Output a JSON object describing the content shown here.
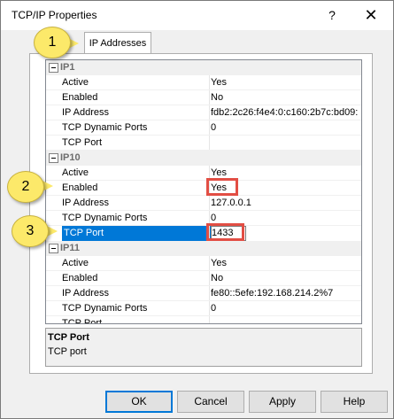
{
  "window": {
    "title": "TCP/IP Properties",
    "help": "?",
    "close": "✕"
  },
  "tabs": [
    {
      "label": "IP Addresses"
    }
  ],
  "grid": {
    "sections": [
      {
        "name": "IP1",
        "rows": [
          {
            "label": "Active",
            "value": "Yes"
          },
          {
            "label": "Enabled",
            "value": "No"
          },
          {
            "label": "IP Address",
            "value": "fdb2:2c26:f4e4:0:c160:2b7c:bd09:"
          },
          {
            "label": "TCP Dynamic Ports",
            "value": "0"
          },
          {
            "label": "TCP Port",
            "value": ""
          }
        ]
      },
      {
        "name": "IP10",
        "rows": [
          {
            "label": "Active",
            "value": "Yes"
          },
          {
            "label": "Enabled",
            "value": "Yes"
          },
          {
            "label": "IP Address",
            "value": "127.0.0.1"
          },
          {
            "label": "TCP Dynamic Ports",
            "value": "0"
          },
          {
            "label": "TCP Port",
            "value": "1433"
          }
        ]
      },
      {
        "name": "IP11",
        "rows": [
          {
            "label": "Active",
            "value": "Yes"
          },
          {
            "label": "Enabled",
            "value": "No"
          },
          {
            "label": "IP Address",
            "value": "fe80::5efe:192.168.214.2%7"
          },
          {
            "label": "TCP Dynamic Ports",
            "value": "0"
          },
          {
            "label": "TCP Port",
            "value": ""
          }
        ]
      }
    ],
    "scroll_up": "▲",
    "scroll_down": "▼"
  },
  "description": {
    "title": "TCP Port",
    "text": "TCP port"
  },
  "buttons": {
    "ok": "OK",
    "cancel": "Cancel",
    "apply": "Apply",
    "help": "Help"
  },
  "callouts": [
    "1",
    "2",
    "3"
  ],
  "colors": {
    "selection": "#0078d7",
    "highlight_box": "#e24e44",
    "callout": "#fce96a"
  }
}
